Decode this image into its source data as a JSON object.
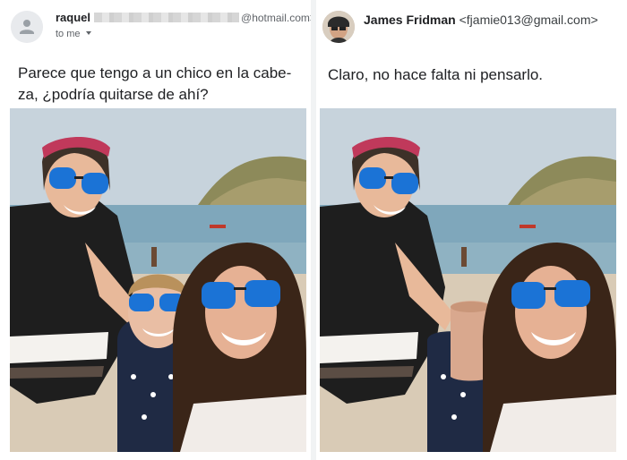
{
  "left_email": {
    "sender_name": "raquel",
    "sender_email_suffix": "@hotmail.com>",
    "recipient_label": "to me",
    "message_line1": "Parece que tengo a un chico en la cabe-",
    "message_line2": "za, ¿podría quitarse de ahí?",
    "avatar_icon": "person-icon",
    "recipient_icon": "chevron-down-icon"
  },
  "right_email": {
    "sender_name": "James Fridman",
    "sender_email": "<fjamie013@gmail.com>",
    "message": "Claro, no hace falta ni pensarlo."
  }
}
